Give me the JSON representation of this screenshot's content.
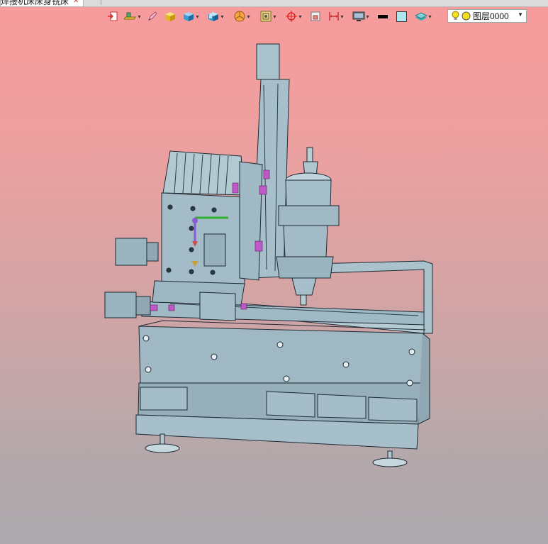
{
  "tab": {
    "title": "焊接机床床身铣床",
    "close_glyph": "✕"
  },
  "toolbar": {
    "items": [
      {
        "name": "exit-sketch-icon"
      },
      {
        "name": "bench-tool-icon",
        "dropdown": true
      },
      {
        "name": "pencil-icon"
      },
      {
        "name": "yellow-cube-icon"
      },
      {
        "name": "blue-cube-icon",
        "dropdown": true
      },
      {
        "name": "shaded-cube-icon",
        "dropdown": true
      },
      {
        "name": "pie-render-icon",
        "dropdown": true
      },
      {
        "name": "frame-render-icon",
        "dropdown": true
      },
      {
        "name": "crosshair-icon",
        "dropdown": true
      },
      {
        "name": "zoom-box-icon"
      },
      {
        "name": "dimension-icon",
        "dropdown": true
      },
      {
        "name": "monitor-icon",
        "dropdown": true
      },
      {
        "name": "line-color-swatch",
        "color": "#000000"
      },
      {
        "name": "fill-color-swatch",
        "color": "#aee4ee"
      },
      {
        "name": "layers-icon",
        "dropdown": true
      }
    ]
  },
  "layer": {
    "label": "图层0000",
    "bulb_color": "#f4e11a",
    "state_color": "#f4e11a"
  },
  "viewport": {
    "background_top": "#f79b9b",
    "background_bottom": "#aeaaae",
    "model_color": "#9fb8c3",
    "accent_color": "#c158c8"
  }
}
